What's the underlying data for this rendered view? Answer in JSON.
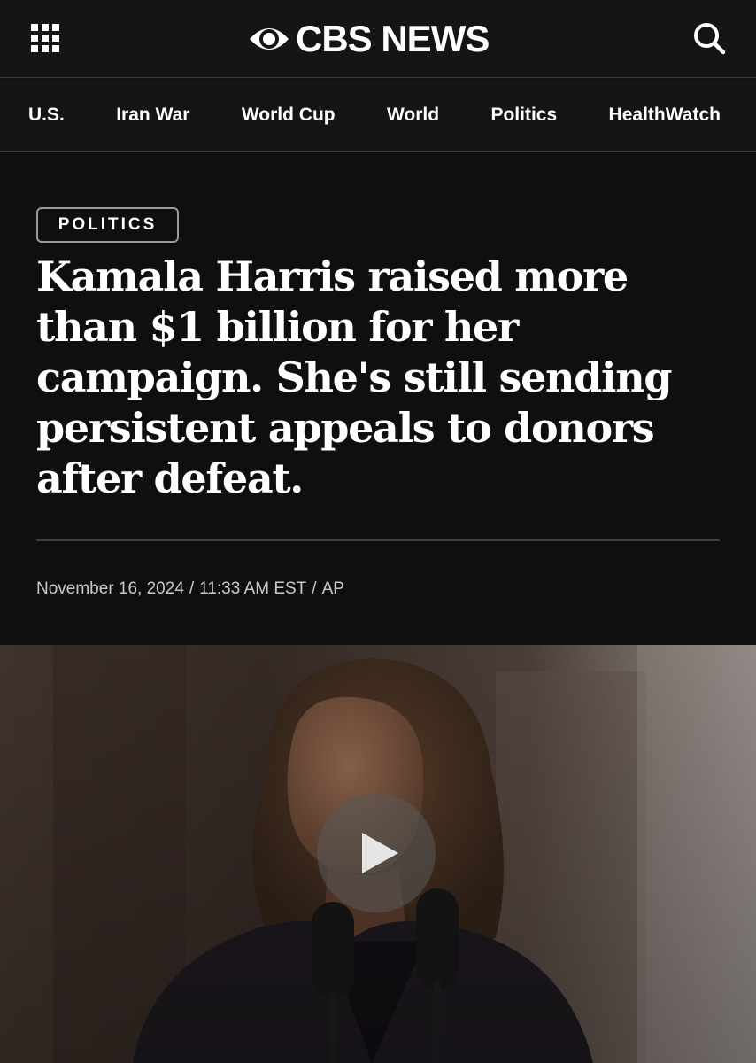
{
  "header": {
    "menu_icon": "grid-menu-icon",
    "brand": "CBS NEWS",
    "brand_icon": "cbs-eye-logo",
    "search_icon": "search-icon"
  },
  "nav": {
    "items": [
      "U.S.",
      "Iran War",
      "World Cup",
      "World",
      "Politics",
      "HealthWatch"
    ]
  },
  "article": {
    "category": "POLITICS",
    "headline": "Kamala Harris raised more than $1 billion for her campaign. She's still sending persistent appeals to donors after defeat.",
    "date": "November 16, 2024",
    "time": "11:33 AM EST",
    "source": "AP",
    "sep": "/"
  },
  "media": {
    "play_icon": "play-icon"
  },
  "colors": {
    "background": "#0f0f0f",
    "bar": "#151515",
    "text": "#ffffff",
    "meta_text": "#c9c9c9",
    "badge_border": "#9a9a9a"
  }
}
